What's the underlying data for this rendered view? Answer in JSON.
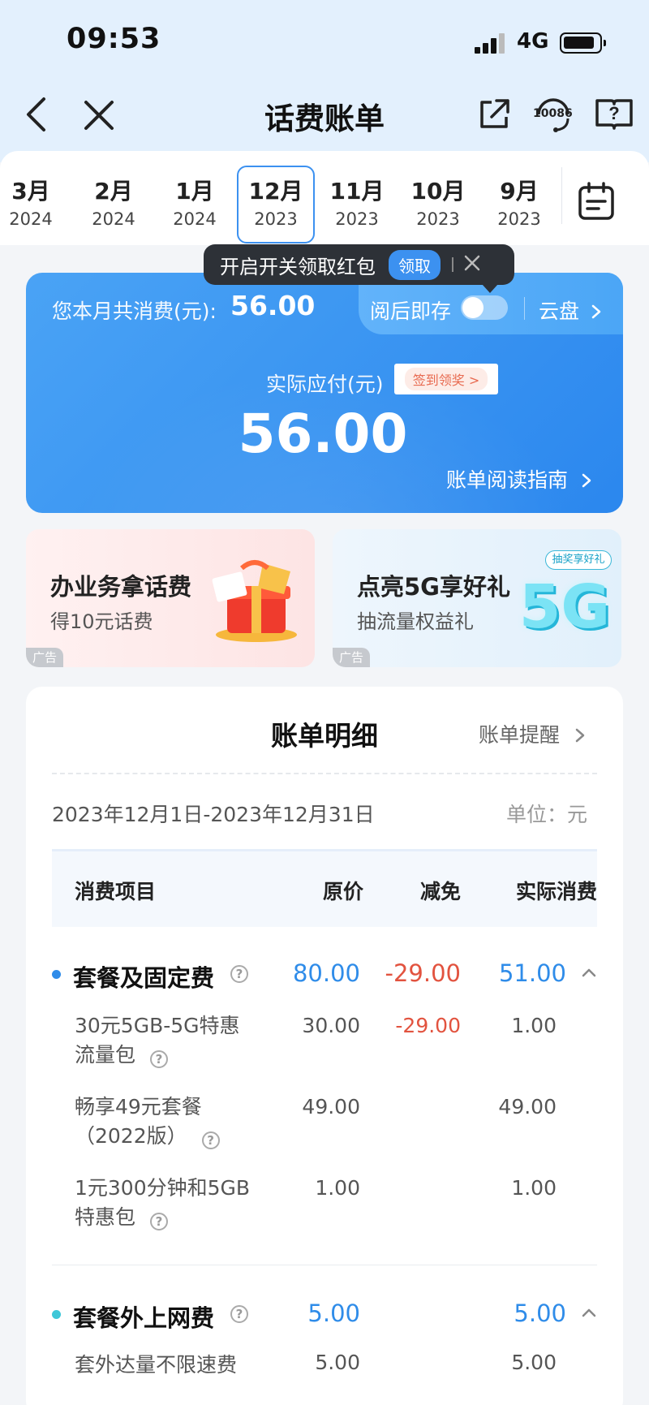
{
  "status_bar": {
    "time": "09:53",
    "network": "4G"
  },
  "nav": {
    "title": "话费账单",
    "service_icon_label": "10086"
  },
  "months": [
    {
      "month": "3月",
      "year": "2024"
    },
    {
      "month": "2月",
      "year": "2024"
    },
    {
      "month": "1月",
      "year": "2024"
    },
    {
      "month": "12月",
      "year": "2023",
      "active": true
    },
    {
      "month": "11月",
      "year": "2023"
    },
    {
      "month": "10月",
      "year": "2023"
    },
    {
      "month": "9月",
      "year": "2023"
    }
  ],
  "tooltip": {
    "text": "开启开关领取红包",
    "button": "领取"
  },
  "summary": {
    "monthly_label": "您本月共消费(元):",
    "monthly_amount": "56.00",
    "read_save_label": "阅后即存",
    "read_save_on": false,
    "cloud_label": "云盘",
    "actual_label": "实际应付(元)",
    "sign_label": "签到领奖 >",
    "actual_amount": "56.00",
    "guide_label": "账单阅读指南"
  },
  "ads": [
    {
      "title": "办业务拿话费",
      "subtitle": "得10元话费",
      "tag": "广告"
    },
    {
      "title": "点亮5G享好礼",
      "subtitle": "抽流量权益礼",
      "tag": "广告",
      "badge": "抽奖享好礼",
      "art_text": "5G"
    }
  ],
  "detail": {
    "title": "账单明细",
    "remind_label": "账单提醒",
    "range": "2023年12月1日-2023年12月31日",
    "unit": "单位：元",
    "columns": [
      "消费项目",
      "原价",
      "减免",
      "实际消费"
    ],
    "sections": [
      {
        "name": "套餐及固定费",
        "original": "80.00",
        "discount": "-29.00",
        "actual": "51.00",
        "items": [
          {
            "name_line1": "30元5GB-5G特惠",
            "name_line2": "流量包",
            "original": "30.00",
            "discount": "-29.00",
            "actual": "1.00"
          },
          {
            "name_line1": "畅享49元套餐",
            "name_line2": "（2022版）",
            "original": "49.00",
            "discount": "",
            "actual": "49.00"
          },
          {
            "name_line1": "1元300分钟和5GB",
            "name_line2": "特惠包",
            "original": "1.00",
            "discount": "",
            "actual": "1.00"
          }
        ]
      },
      {
        "name": "套餐外上网费",
        "original": "5.00",
        "discount": "",
        "actual": "5.00",
        "items": [
          {
            "name_line1": "套外达量不限速费",
            "original": "5.00",
            "discount": "",
            "actual": "5.00"
          }
        ]
      }
    ]
  },
  "colors": {
    "accent_blue": "#2f8ce9",
    "discount_red": "#e2533f",
    "card_blue": "#2b87ee"
  }
}
